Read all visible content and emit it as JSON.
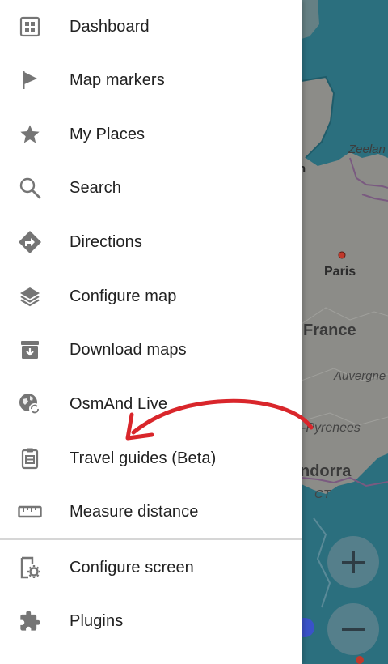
{
  "menu": {
    "items": [
      {
        "label": "Dashboard",
        "icon": "dashboard-icon"
      },
      {
        "label": "Map markers",
        "icon": "flag-icon"
      },
      {
        "label": "My Places",
        "icon": "star-icon"
      },
      {
        "label": "Search",
        "icon": "search-icon"
      },
      {
        "label": "Directions",
        "icon": "directions-icon"
      },
      {
        "label": "Configure map",
        "icon": "layers-icon"
      },
      {
        "label": "Download maps",
        "icon": "download-archive-icon"
      },
      {
        "label": "OsmAnd Live",
        "icon": "globe-sync-icon"
      },
      {
        "label": "Travel guides (Beta)",
        "icon": "clipboard-icon"
      },
      {
        "label": "Measure distance",
        "icon": "ruler-icon"
      }
    ],
    "secondary_items": [
      {
        "label": "Configure screen",
        "icon": "screen-settings-icon"
      },
      {
        "label": "Plugins",
        "icon": "puzzle-icon"
      }
    ]
  },
  "map": {
    "labels": {
      "zeeland": "Zeelan",
      "n": "n",
      "paris": "Paris",
      "france": "France",
      "auvergne": "Auvergne",
      "pyrenees": "-Pyrenees",
      "andorra": "ndorra",
      "ct": "CT"
    }
  },
  "colors": {
    "icon": "#757575",
    "text": "#212121",
    "annotation_arrow": "#d9262b",
    "sea": "#2b6f7e",
    "land": "#8a8a86"
  }
}
